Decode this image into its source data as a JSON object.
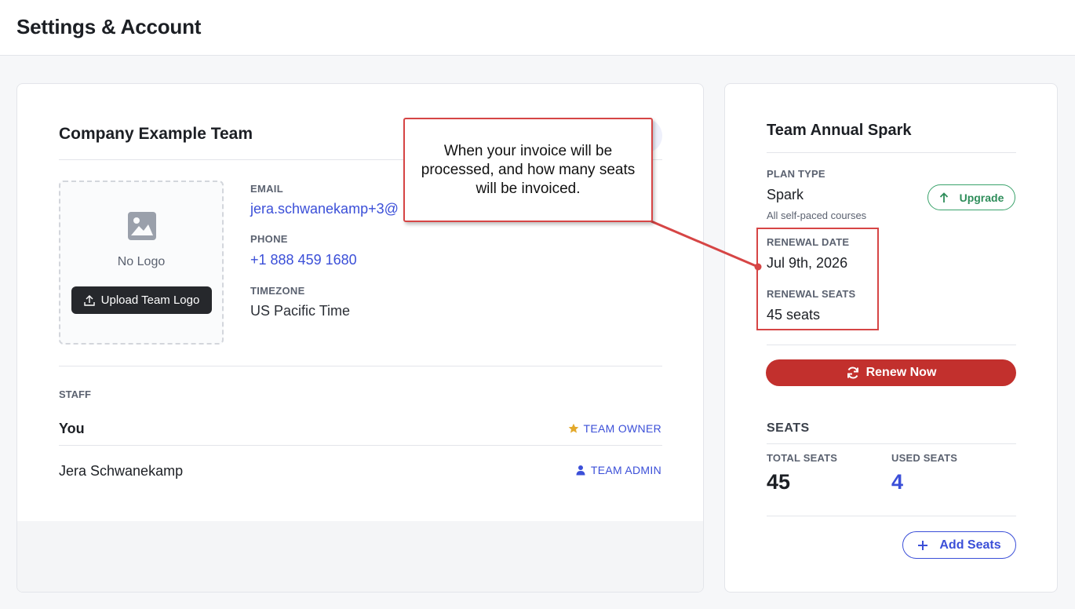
{
  "header": {
    "title": "Settings & Account"
  },
  "team": {
    "name": "Company Example Team",
    "logo": {
      "empty_text": "No Logo",
      "upload_label": "Upload Team Logo"
    },
    "email_label": "EMAIL",
    "email_value": "jera.schwanekamp+3@",
    "phone_label": "PHONE",
    "phone_value": "+1 888 459 1680",
    "timezone_label": "TIMEZONE",
    "timezone_value": "US Pacific Time"
  },
  "staff": {
    "label": "STAFF",
    "members": [
      {
        "name": "You",
        "role": "TEAM OWNER",
        "role_icon": "star-icon"
      },
      {
        "name": "Jera Schwanekamp",
        "role": "TEAM ADMIN",
        "role_icon": "user-icon"
      }
    ]
  },
  "plan": {
    "title": "Team Annual Spark",
    "plan_type_label": "PLAN TYPE",
    "plan_type_value": "Spark",
    "plan_type_sub": "All self-paced courses",
    "upgrade_label": "Upgrade",
    "renewal_date_label": "RENEWAL DATE",
    "renewal_date_value": "Jul 9th, 2026",
    "renewal_seats_label": "RENEWAL SEATS",
    "renewal_seats_value": "45 seats",
    "renew_label": "Renew Now"
  },
  "seats": {
    "heading": "SEATS",
    "total_label": "TOTAL SEATS",
    "total_value": "45",
    "used_label": "USED SEATS",
    "used_value": "4",
    "add_label": "Add Seats"
  },
  "annotation": {
    "text": "When your invoice will be processed, and how many seats will be invoiced."
  },
  "colors": {
    "link": "#3b4fd8",
    "renew": "#c2302d",
    "upgrade": "#2e8d5a",
    "annotation": "#d64545",
    "owner_star": "#e3a92b"
  }
}
